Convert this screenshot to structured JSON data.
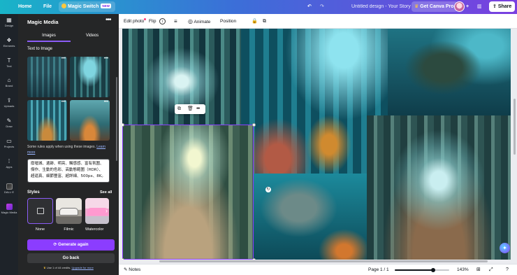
{
  "topbar": {
    "home": "Home",
    "file": "File",
    "magic_switch": "Magic Switch",
    "new_badge": "NEW",
    "doc_title": "Untitled design - Your Story",
    "get_pro": "Get Canva Pro",
    "share": "Share",
    "undo_icon": "↶",
    "redo_icon": "↷",
    "plus_icon": "+",
    "chart_icon": "▥"
  },
  "rail": {
    "items": [
      {
        "label": "Design",
        "icon": "▦"
      },
      {
        "label": "Elements",
        "icon": "❖"
      },
      {
        "label": "Text",
        "icon": "T"
      },
      {
        "label": "Brand",
        "icon": "⌂"
      },
      {
        "label": "Uploads",
        "icon": "⇪"
      },
      {
        "label": "Draw",
        "icon": "✎"
      },
      {
        "label": "Projects",
        "icon": "▭"
      },
      {
        "label": "Apps",
        "icon": "⁞"
      },
      {
        "label": "DALL·E",
        "icon": ""
      },
      {
        "label": "Magic Media",
        "icon": ""
      }
    ]
  },
  "panel": {
    "title": "Magic Media",
    "more": "•••",
    "tabs": [
      "Images",
      "Videos"
    ],
    "subheading": "Text to Image",
    "thumb_more": "•••",
    "note": "Some rules apply when using these images.",
    "note_link": "Learn more",
    "prompt": "廢墟城、遺跡、明亮、觸感感、富有氛圍、傑作、生動的色彩、高動態範圍（HDR）、超逼真、細節豐富、超詳細、500px、8K。",
    "styles_heading": "Styles",
    "see_all": "See all",
    "styles": [
      "None",
      "Filmic",
      "Watercolor"
    ],
    "style_arrow": "›",
    "generate_again": "Generate again",
    "generate_icon": "⟳",
    "go_back": "Go back",
    "credits": "Use 1 of 44 credits.",
    "credits_link": "Upgrade for more"
  },
  "toolbar": {
    "edit_photo": "Edit photo",
    "flip": "Flip",
    "info_icon": "i",
    "lines_icon": "≡",
    "animate": "Animate",
    "animate_icon": "◎",
    "position": "Position",
    "lock_icon": "🔒",
    "copy_icon": "⧉"
  },
  "canvas": {
    "float_icons": [
      "⧉",
      "🗑",
      "•••"
    ],
    "rotate_icon": "↻",
    "add_icon": "✦"
  },
  "bottom": {
    "notes": "Notes",
    "notes_icon": "✎",
    "page": "Page 1 / 1",
    "zoom": "143%",
    "zoom_level": 0.7,
    "grid_icon": "⊞",
    "fullscreen_icon": "⤢",
    "help_icon": "?"
  },
  "colors": {
    "accent": "#8b3dff",
    "panel_bg": "#252627",
    "rail_bg": "#1e2329"
  }
}
